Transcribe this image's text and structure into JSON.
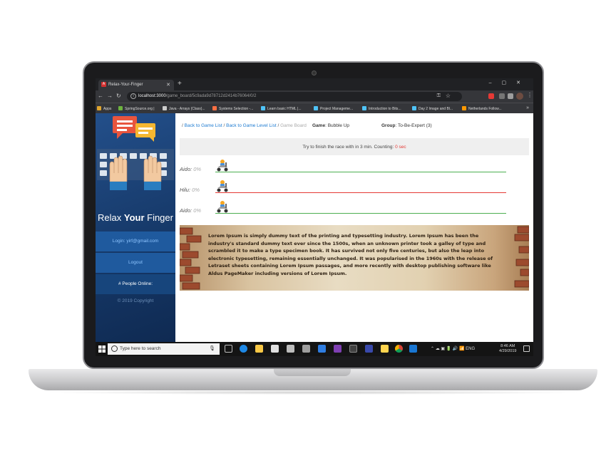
{
  "browser": {
    "tab_title": "Relax-Your-Finger",
    "tab_favicon_letter": "A",
    "url_host": "localhost:3000",
    "url_path": "/game_board/5c9ada9d78712d2414b76064/0/2",
    "bookmarks": [
      {
        "label": "Apps",
        "color": "#e0a52e"
      },
      {
        "label": "SpringSource.org |",
        "color": "#6db33f"
      },
      {
        "label": "Java - Arrays (Class)...",
        "color": "#cccccc"
      },
      {
        "label": "Systems Selection -...",
        "color": "#ff7043"
      },
      {
        "label": "Learn basic HTML |...",
        "color": "#4fc3f7"
      },
      {
        "label": "Project Manageme...",
        "color": "#4fc3f7"
      },
      {
        "label": "Introduction to Bits...",
        "color": "#4fc3f7"
      },
      {
        "label": "Day 2 Image and Bl...",
        "color": "#4fc3f7"
      },
      {
        "label": "Netherlands Follow...",
        "color": "#ff9800"
      }
    ],
    "more_bookmarks": "»"
  },
  "sidebar": {
    "brand_prefix": "Relax ",
    "brand_bold": "Your",
    "brand_suffix": " Finger",
    "login_text": "Login: yirf@gmail.com",
    "logout_text": "Logout",
    "people_online": "# People Online:",
    "copyright": "© 2019 Copyright"
  },
  "breadcrumb": {
    "sep": "/",
    "back_game_list": "Back to Game List",
    "back_level_list": "Back to Game Level List",
    "current": "Game Board"
  },
  "game": {
    "game_label": "Game",
    "game_value": ": Bubble Up",
    "group_label": "Group",
    "group_value": ": To-Be-Expert (3)"
  },
  "alert": {
    "text": "Try to finish the race with in 3 min. Counting: ",
    "count": "0 sec"
  },
  "racers": [
    {
      "name": "Aido:",
      "percent": "0%",
      "progress": 0,
      "track_color": "#4caf50"
    },
    {
      "name": "Hilu:",
      "percent": "0%",
      "progress": 0,
      "track_color": "#e53935"
    },
    {
      "name": "Aido:",
      "percent": "0%",
      "progress": 0,
      "track_color": "#4caf50"
    }
  ],
  "banner": {
    "text": "Lorem Ipsum is simply dummy text of the printing and typesetting industry. Lorem Ipsum has been the industry's standard dummy text ever since the 1500s, when an unknown printer took a galley of type and scrambled it to make a type specimen book. It has survived not only five centuries, but also the leap into electronic typesetting, remaining essentially unchanged. It was popularised in the 1960s with the release of Letraset sheets containing Lorem Ipsum passages, and more recently with desktop publishing software like Aldus PageMaker including versions of Lorem Ipsum."
  },
  "taskbar": {
    "search_placeholder": "Type here to search",
    "lang": "ENG",
    "time": "8:46 AM",
    "date": "4/29/2019",
    "icons": [
      "task-view",
      "edge",
      "file-explorer",
      "store",
      "mail",
      "calendar",
      "todo",
      "onenote",
      "terminal",
      "teams",
      "sticky-notes",
      "chrome",
      "vscode"
    ]
  }
}
